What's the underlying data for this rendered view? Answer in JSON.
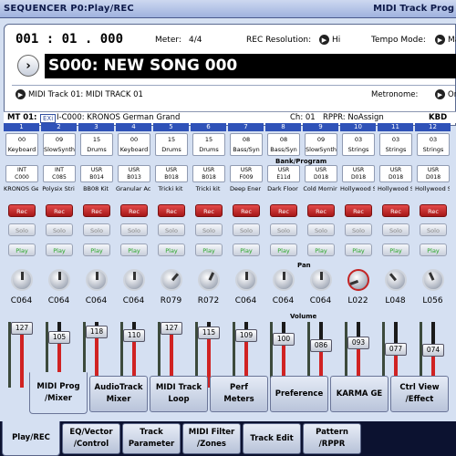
{
  "titlebar": {
    "mode": "SEQUENCER P0:Play/REC",
    "page": "MIDI Track Prog"
  },
  "header": {
    "location": "001 : 01 . 000",
    "meter_label": "Meter:",
    "meter_value": "4/4",
    "rec_res_label": "REC Resolution:",
    "rec_res_value": "Hi",
    "tempo_label": "Tempo Mode:",
    "tempo_value": "Ma",
    "song_name": "S000: NEW SONG 000",
    "track_select": "MIDI Track 01: MIDI TRACK 01",
    "metronome_label": "Metronome:",
    "metronome_value": "On"
  },
  "infobar": {
    "track": "MT 01:",
    "exi": "EXi",
    "program": "I-C000: KRONOS German Grand",
    "channel": "Ch: 01",
    "rppr": "RPPR: NoAssign",
    "kbd": "KBD"
  },
  "labels": {
    "bank_program": "Bank/Program",
    "pan": "Pan",
    "volume": "Volume",
    "rec": "Rec",
    "solo": "Solo",
    "play": "Play"
  },
  "channels": [
    {
      "num": "1",
      "prog_num": "00",
      "prog_cat": "Keyboard",
      "bank_a": "INT",
      "bank_b": "C000",
      "pname": "KRONOS Ge",
      "pan": "C064",
      "volume": "127",
      "knob_deg": 0,
      "red_knob": false
    },
    {
      "num": "2",
      "prog_num": "09",
      "prog_cat": "SlowSynth",
      "bank_a": "INT",
      "bank_b": "C085",
      "pname": "Polysix Stri",
      "pan": "C064",
      "volume": "105",
      "knob_deg": 0,
      "red_knob": false
    },
    {
      "num": "3",
      "prog_num": "15",
      "prog_cat": "Drums",
      "bank_a": "USR",
      "bank_b": "B014",
      "pname": "BB08 Kit",
      "pan": "C064",
      "volume": "118",
      "knob_deg": 0,
      "red_knob": false
    },
    {
      "num": "4",
      "prog_num": "00",
      "prog_cat": "Keyboard",
      "bank_a": "USR",
      "bank_b": "B013",
      "pname": "Granular Ac",
      "pan": "C064",
      "volume": "110",
      "knob_deg": 0,
      "red_knob": false
    },
    {
      "num": "5",
      "prog_num": "15",
      "prog_cat": "Drums",
      "bank_a": "USR",
      "bank_b": "B018",
      "pname": "Tricki kit",
      "pan": "R079",
      "volume": "127",
      "knob_deg": 40,
      "red_knob": false
    },
    {
      "num": "6",
      "prog_num": "15",
      "prog_cat": "Drums",
      "bank_a": "USR",
      "bank_b": "B018",
      "pname": "Tricki kit",
      "pan": "R072",
      "volume": "115",
      "knob_deg": 25,
      "red_knob": false
    },
    {
      "num": "7",
      "prog_num": "08",
      "prog_cat": "Bass/Syn",
      "bank_a": "USR",
      "bank_b": "F009",
      "pname": "Deep Ener",
      "pan": "C064",
      "volume": "109",
      "knob_deg": 0,
      "red_knob": false
    },
    {
      "num": "8",
      "prog_num": "08",
      "prog_cat": "Bass/Syn",
      "bank_a": "USR",
      "bank_b": "E11d",
      "pname": "Dark Floor",
      "pan": "C064",
      "volume": "100",
      "knob_deg": 0,
      "red_knob": false
    },
    {
      "num": "9",
      "prog_num": "09",
      "prog_cat": "SlowSynth",
      "bank_a": "USR",
      "bank_b": "D018",
      "pname": "Cold Mornir",
      "pan": "C064",
      "volume": "086",
      "knob_deg": 0,
      "red_knob": false
    },
    {
      "num": "10",
      "prog_num": "03",
      "prog_cat": "Strings",
      "bank_a": "USR",
      "bank_b": "D018",
      "pname": "Hollywood S",
      "pan": "L022",
      "volume": "093",
      "knob_deg": -110,
      "red_knob": true
    },
    {
      "num": "11",
      "prog_num": "03",
      "prog_cat": "Strings",
      "bank_a": "USR",
      "bank_b": "D018",
      "pname": "Hollywood S",
      "pan": "L048",
      "volume": "077",
      "knob_deg": -40,
      "red_knob": false
    },
    {
      "num": "12",
      "prog_num": "03",
      "prog_cat": "Strings",
      "bank_a": "USR",
      "bank_b": "D018",
      "pname": "Hollywood S",
      "pan": "L056",
      "volume": "074",
      "knob_deg": -25,
      "red_knob": false
    }
  ],
  "tabs_upper": [
    {
      "line1": "MIDI Prog",
      "line2": "/Mixer",
      "active": true
    },
    {
      "line1": "AudioTrack",
      "line2": "Mixer",
      "active": false
    },
    {
      "line1": "MIDI Track",
      "line2": "Loop",
      "active": false
    },
    {
      "line1": "Perf",
      "line2": "Meters",
      "active": false
    },
    {
      "line1": "Preference",
      "line2": "",
      "active": false
    },
    {
      "line1": "KARMA GE",
      "line2": "",
      "active": false
    },
    {
      "line1": "Ctrl View",
      "line2": "/Effect",
      "active": false
    }
  ],
  "tabs_lower": [
    {
      "line1": "Play/REC",
      "line2": "",
      "active": true
    },
    {
      "line1": "EQ/Vector",
      "line2": "/Control",
      "active": false
    },
    {
      "line1": "Track",
      "line2": "Parameter",
      "active": false
    },
    {
      "line1": "MIDI Filter",
      "line2": "/Zones",
      "active": false
    },
    {
      "line1": "Track Edit",
      "line2": "",
      "active": false
    },
    {
      "line1": "Pattern",
      "line2": "/RPPR",
      "active": false
    }
  ]
}
